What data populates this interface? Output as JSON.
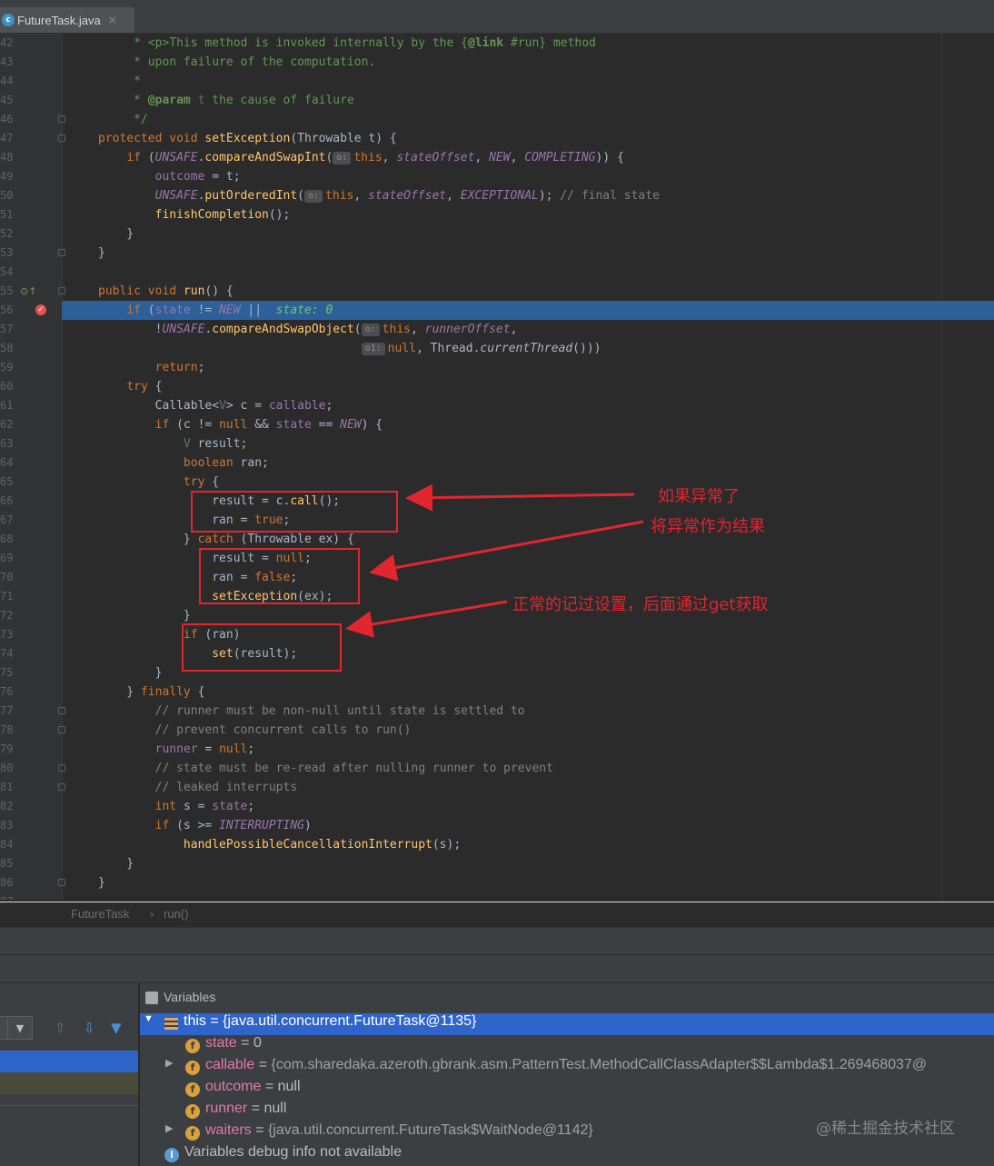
{
  "tab": {
    "icon": "c",
    "label": "FutureTask.java",
    "close": "×"
  },
  "code_lines": [
    {
      "n": "42",
      "h": "<span class=\"jdoc\">     * &lt;p&gt;This method is invoked internally by the {</span><span class=\"jtag\">@link</span><span class=\"jdoc\"> #run} method</span>"
    },
    {
      "n": "43",
      "h": "<span class=\"jdoc\">     * upon failure of the computation.</span>"
    },
    {
      "n": "44",
      "h": "<span class=\"jdoc\">     *</span>"
    },
    {
      "n": "45",
      "h": "<span class=\"jdoc\">     * </span><span class=\"jtag\">@param</span><span class=\"jdoc\"> </span><span class=\"tp\">t</span><span class=\"jdoc\"> the cause of failure</span>"
    },
    {
      "n": "46",
      "h": "<span class=\"jdoc\">     */</span>"
    },
    {
      "n": "47",
      "h": "<span class=\"kw\">protected void </span><span class=\"fn\">setException</span>(Throwable t) {"
    },
    {
      "n": "48",
      "h": "    <span class=\"kw\">if </span>(<span class=\"sfld\">UNSAFE</span>.<span class=\"fn\">compareAndSwapInt</span>(<span class=\"hint\">o:</span><span class=\"kw\">this</span>, <span class=\"sfld\">stateOffset</span>, <span class=\"sfld\">NEW</span>, <span class=\"sfld\">COMPLETING</span>)) {"
    },
    {
      "n": "49",
      "h": "        <span class=\"fld\">outcome</span> = t;"
    },
    {
      "n": "50",
      "h": "        <span class=\"sfld\">UNSAFE</span>.<span class=\"fn\">putOrderedInt</span>(<span class=\"hint\">o:</span><span class=\"kw\">this</span>, <span class=\"sfld\">stateOffset</span>, <span class=\"sfld\">EXCEPTIONAL</span>); <span class=\"cmt\">// final state</span>"
    },
    {
      "n": "51",
      "h": "        <span class=\"fn\">finishCompletion</span>();"
    },
    {
      "n": "52",
      "h": "    }"
    },
    {
      "n": "53",
      "h": "}"
    },
    {
      "n": "54",
      "h": ""
    },
    {
      "n": "55",
      "h": "<span class=\"kw\">public void </span><span class=\"fn\">run</span>() {"
    },
    {
      "n": "56",
      "h": "    <span class=\"kw\">if </span>(<span class=\"fld\">state</span> != <span class=\"sfld\">NEW</span> ||  <span class=\"inl\">state: 0</span>"
    },
    {
      "n": "57",
      "h": "        !<span class=\"sfld\">UNSAFE</span>.<span class=\"fn\">compareAndSwapObject</span>(<span class=\"hint\">o:</span><span class=\"kw\">this</span>, <span class=\"sfld\">runnerOffset</span>,"
    },
    {
      "n": "58",
      "h": "                                     <span class=\"hint\">o1:</span><span class=\"kw\">null</span>, Thread.<span class=\"sub\">currentThread</span>()))"
    },
    {
      "n": "59",
      "h": "        <span class=\"kw\">return</span>;"
    },
    {
      "n": "60",
      "h": "    <span class=\"kw\">try </span>{"
    },
    {
      "n": "61",
      "h": "        Callable&lt;<span class=\"tp\">V</span>&gt; c = <span class=\"fld\">callable</span>;"
    },
    {
      "n": "62",
      "h": "        <span class=\"kw\">if </span>(c != <span class=\"kw\">null </span>&amp;&amp; <span class=\"fld\">state</span> == <span class=\"sfld\">NEW</span>) {"
    },
    {
      "n": "63",
      "h": "            <span class=\"tp\">V</span> result;"
    },
    {
      "n": "64",
      "h": "            <span class=\"kw\">boolean </span>ran;"
    },
    {
      "n": "65",
      "h": "            <span class=\"kw\">try </span>{"
    },
    {
      "n": "66",
      "h": "                result = c.<span class=\"fn\">call</span>();"
    },
    {
      "n": "67",
      "h": "                ran = <span class=\"kw\">true</span>;"
    },
    {
      "n": "68",
      "h": "            } <span class=\"kw\">catch </span>(Throwable ex) {"
    },
    {
      "n": "69",
      "h": "                result = <span class=\"kw\">null</span>;"
    },
    {
      "n": "70",
      "h": "                ran = <span class=\"kw\">false</span>;"
    },
    {
      "n": "71",
      "h": "                <span class=\"fn\">setException</span>(ex);"
    },
    {
      "n": "72",
      "h": "            }"
    },
    {
      "n": "73",
      "h": "            <span class=\"kw\">if </span>(ran)"
    },
    {
      "n": "74",
      "h": "                <span class=\"fn\">set</span>(result);"
    },
    {
      "n": "75",
      "h": "        }"
    },
    {
      "n": "76",
      "h": "    } <span class=\"kw\">finally </span>{"
    },
    {
      "n": "77",
      "h": "        <span class=\"cmt\">// runner must be non-null until state is settled to</span>"
    },
    {
      "n": "78",
      "h": "        <span class=\"cmt\">// prevent concurrent calls to run()</span>"
    },
    {
      "n": "79",
      "h": "        <span class=\"fld\">runner</span> = <span class=\"kw\">null</span>;"
    },
    {
      "n": "80",
      "h": "        <span class=\"cmt\">// state must be re-read after nulling runner to prevent</span>"
    },
    {
      "n": "81",
      "h": "        <span class=\"cmt\">// leaked interrupts</span>"
    },
    {
      "n": "82",
      "h": "        <span class=\"kw\">int </span>s = <span class=\"fld\">state</span>;"
    },
    {
      "n": "83",
      "h": "        <span class=\"kw\">if </span>(s &gt;= <span class=\"sfld\">INTERRUPTING</span>)"
    },
    {
      "n": "84",
      "h": "            <span class=\"fn\">handlePossibleCancellationInterrupt</span>(s);"
    },
    {
      "n": "85",
      "h": "    }"
    },
    {
      "n": "86",
      "h": "}"
    },
    {
      "n": "87",
      "h": ""
    }
  ],
  "annotations": {
    "a1": "如果异常了",
    "a2": "将异常作为结果",
    "a3": "正常的记过设置，后面通过get获取"
  },
  "breadcrumb": {
    "class": "FutureTask",
    "sep": "›",
    "method": "run()"
  },
  "variables_panel": {
    "title": "Variables",
    "rows": [
      {
        "name": "this",
        "value": "{java.util.concurrent.FutureTask@1135}"
      },
      {
        "name": "state",
        "value": "0"
      },
      {
        "name": "callable",
        "value": "{com.sharedaka.azeroth.gbrank.asm.PatternTest.MethodCallClassAdapter$$Lambda$1.269468037@"
      },
      {
        "name": "outcome",
        "value": "null"
      },
      {
        "name": "runner",
        "value": "null"
      },
      {
        "name": "waiters",
        "value": "{java.util.concurrent.FutureTask$WaitNode@1142}"
      }
    ],
    "info": "Variables debug info not available",
    "equals": "="
  },
  "watermark": "@稀土掘金技术社区",
  "colors": {
    "annotation_red": "#e0262f",
    "selection_blue": "#2f65ca",
    "exec_line": "#2d6099"
  }
}
